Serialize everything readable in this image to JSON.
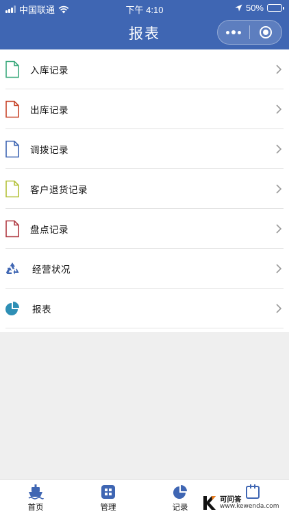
{
  "status_bar": {
    "carrier": "中国联通",
    "time": "下午 4:10",
    "battery": "50%",
    "battery_level": 0.5
  },
  "nav": {
    "title": "报表",
    "more_icon": "more-dots-icon",
    "close_icon": "target-circle-icon"
  },
  "colors": {
    "header": "#3f66b3",
    "green": "#3daa7e",
    "red": "#c8462b",
    "blue": "#3f66b3",
    "yellow": "#b4c13a",
    "darkred": "#b03a42",
    "teal": "#2e8fb5"
  },
  "menu": {
    "items": [
      {
        "label": "入库记录",
        "icon": "document-icon"
      },
      {
        "label": "出库记录",
        "icon": "document-icon"
      },
      {
        "label": "调拨记录",
        "icon": "document-icon"
      },
      {
        "label": "客户退货记录",
        "icon": "document-icon"
      },
      {
        "label": "盘点记录",
        "icon": "document-icon"
      },
      {
        "label": "经营状况",
        "icon": "recycle-icon"
      },
      {
        "label": "报表",
        "icon": "pie-chart-icon"
      }
    ]
  },
  "tabbar": {
    "items": [
      {
        "label": "首页",
        "icon": "ship-icon"
      },
      {
        "label": "管理",
        "icon": "grid-icon"
      },
      {
        "label": "记录",
        "icon": "pie-chart-icon"
      },
      {
        "label": "",
        "icon": "calendar-icon"
      }
    ]
  },
  "watermark": {
    "title": "可问答",
    "url": "www.kewenda.com"
  }
}
